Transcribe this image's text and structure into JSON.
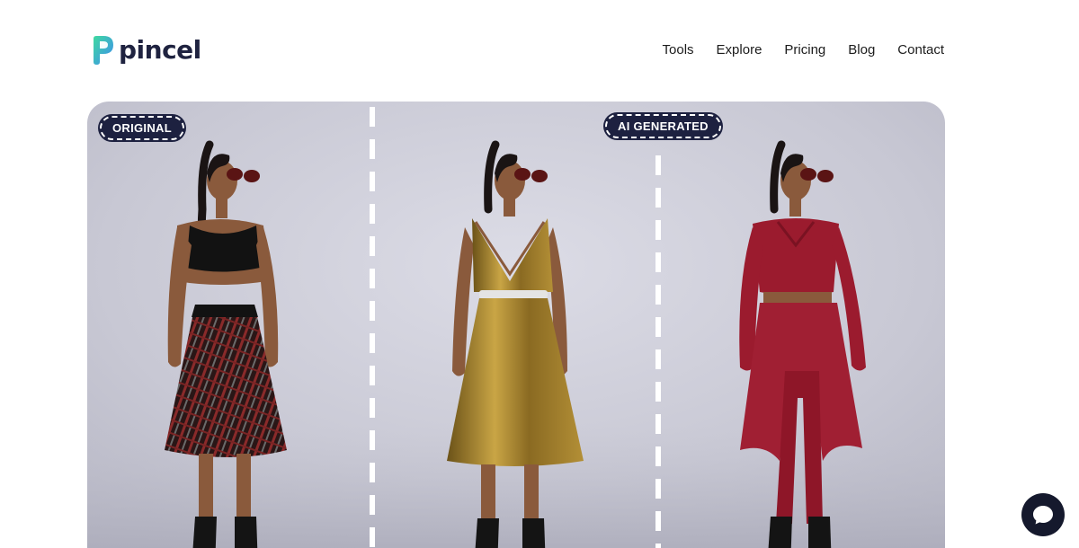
{
  "brand": {
    "name": "pincel"
  },
  "nav": {
    "items": [
      {
        "label": "Tools"
      },
      {
        "label": "Explore"
      },
      {
        "label": "Pricing"
      },
      {
        "label": "Blog"
      },
      {
        "label": "Contact"
      }
    ]
  },
  "hero": {
    "badge_original": "ORIGINAL",
    "badge_ai": "AI GENERATED"
  },
  "colors": {
    "brand_green": "#3fd9a0",
    "brand_blue": "#3e8cf0",
    "brand_text": "#1f2340",
    "badge_bg": "#1d2140",
    "outfit_black": "#141414",
    "outfit_gold": "#9a7a2a",
    "outfit_red": "#9b1b2e"
  },
  "icons": {
    "chat": "chat-bubble-icon"
  }
}
